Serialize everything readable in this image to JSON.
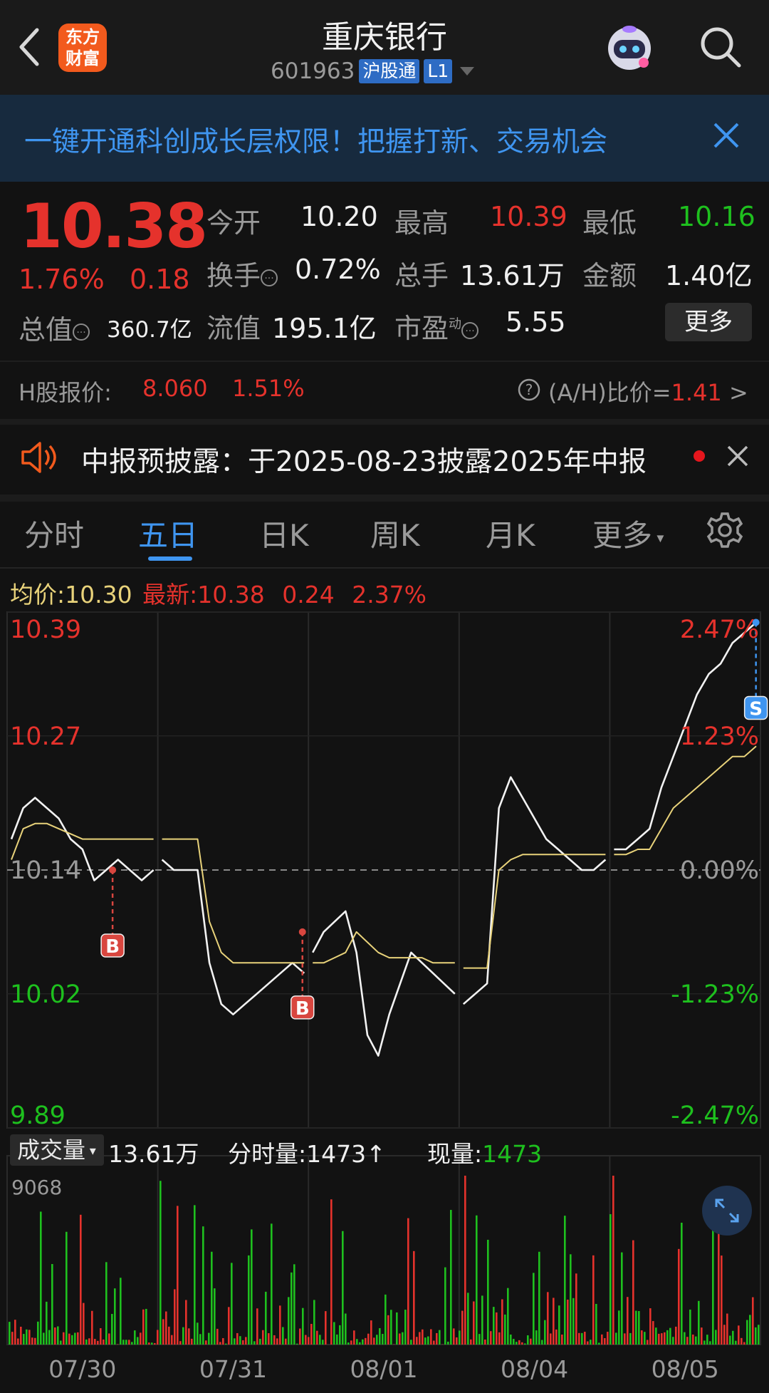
{
  "header": {
    "title": "重庆银行",
    "code": "601963",
    "tag_exchange": "沪股通",
    "tag_level": "L1",
    "logo_line1": "东方",
    "logo_line2": "财富"
  },
  "banner": {
    "text": "一键开通科创成长层权限！把握打新、交易机会"
  },
  "quote": {
    "price": "10.38",
    "change_pct": "1.76%",
    "change": "0.18",
    "open_label": "今开",
    "open": "10.20",
    "high_label": "最高",
    "high": "10.39",
    "low_label": "最低",
    "low": "10.16",
    "turnover_label": "换手",
    "turnover": "0.72%",
    "volume_label": "总手",
    "volume": "13.61万",
    "amount_label": "金额",
    "amount": "1.40亿",
    "mktcap_label": "总值",
    "mktcap": "360.7亿",
    "float_label": "流值",
    "float_cap": "195.1亿",
    "pe_label": "市盈",
    "pe_sup": "动",
    "pe": "5.55",
    "more": "更多"
  },
  "hshare": {
    "label": "H股报价:",
    "price": "8.060",
    "pct": "1.51%",
    "ah_label": "(A/H)比价=",
    "ah_value": "1.41",
    "arrow": ">"
  },
  "notice": {
    "text": "中报预披露：于2025-08-23披露2025年中报"
  },
  "tabs": [
    "分时",
    "五日",
    "日K",
    "周K",
    "月K",
    "更多"
  ],
  "info": {
    "avg_label": "均价:",
    "avg": "10.30",
    "latest_label": "最新:",
    "latest": "10.38",
    "latest_change": "0.24",
    "latest_pct": "2.37%"
  },
  "volume_bar": {
    "selector": "成交量",
    "total": "13.61万",
    "tick_label": "分时量:",
    "tick": "1473",
    "arrow": "↑",
    "now_label": "现量:",
    "now": "1473",
    "max": "9068"
  },
  "colors": {
    "up": "#e5322c",
    "down": "#1ec01e",
    "accent": "#3f95f0",
    "avg_line": "#e8d27a"
  },
  "chart_data": {
    "type": "line",
    "title": "",
    "x": [
      "07/30",
      "07/31",
      "08/01",
      "08/04",
      "08/05"
    ],
    "y_ticks_left": [
      "10.39",
      "10.27",
      "10.14",
      "10.02",
      "9.89"
    ],
    "y_ticks_right": [
      "2.47%",
      "1.23%",
      "0.00%",
      "-1.23%",
      "-2.47%"
    ],
    "ylim": [
      9.89,
      10.39
    ],
    "prev_close": 10.14,
    "series": [
      {
        "values": [
          10.17,
          10.2,
          10.21,
          10.2,
          10.19,
          10.17,
          10.16,
          10.13,
          10.14,
          10.15,
          10.14,
          10.13,
          10.14,
          10.15,
          10.14,
          10.14,
          10.14,
          10.05,
          10.01,
          10.0,
          10.01,
          10.02,
          10.03,
          10.04,
          10.05,
          10.04,
          10.06,
          10.08,
          10.09,
          10.1,
          10.06,
          9.98,
          9.96,
          10.0,
          10.03,
          10.06,
          10.05,
          10.04,
          10.03,
          10.02,
          10.01,
          10.02,
          10.03,
          10.2,
          10.23,
          10.21,
          10.19,
          10.17,
          10.16,
          10.15,
          10.14,
          10.14,
          10.15,
          10.16,
          10.16,
          10.17,
          10.18,
          10.22,
          10.25,
          10.28,
          10.31,
          10.33,
          10.34,
          10.36,
          10.37,
          10.38
        ]
      },
      {
        "values": [
          10.15,
          10.18,
          10.185,
          10.185,
          10.18,
          10.175,
          10.17,
          10.17,
          10.17,
          10.17,
          10.17,
          10.17,
          10.17,
          10.17,
          10.17,
          10.17,
          10.17,
          10.09,
          10.06,
          10.05,
          10.05,
          10.05,
          10.05,
          10.05,
          10.05,
          10.05,
          10.05,
          10.05,
          10.055,
          10.06,
          10.08,
          10.07,
          10.06,
          10.055,
          10.055,
          10.055,
          10.055,
          10.05,
          10.05,
          10.05,
          10.045,
          10.045,
          10.045,
          10.14,
          10.15,
          10.155,
          10.155,
          10.155,
          10.155,
          10.155,
          10.155,
          10.155,
          10.155,
          10.155,
          10.155,
          10.16,
          10.16,
          10.18,
          10.2,
          10.21,
          10.22,
          10.23,
          10.24,
          10.25,
          10.25,
          10.26
        ]
      }
    ],
    "markers": [
      {
        "label": "B",
        "day": "07/30",
        "price": 10.14
      },
      {
        "label": "B",
        "day": "07/31",
        "price": 10.08
      },
      {
        "label": "S",
        "day": "08/05",
        "price": 10.38
      }
    ],
    "volume_max": 9068
  }
}
